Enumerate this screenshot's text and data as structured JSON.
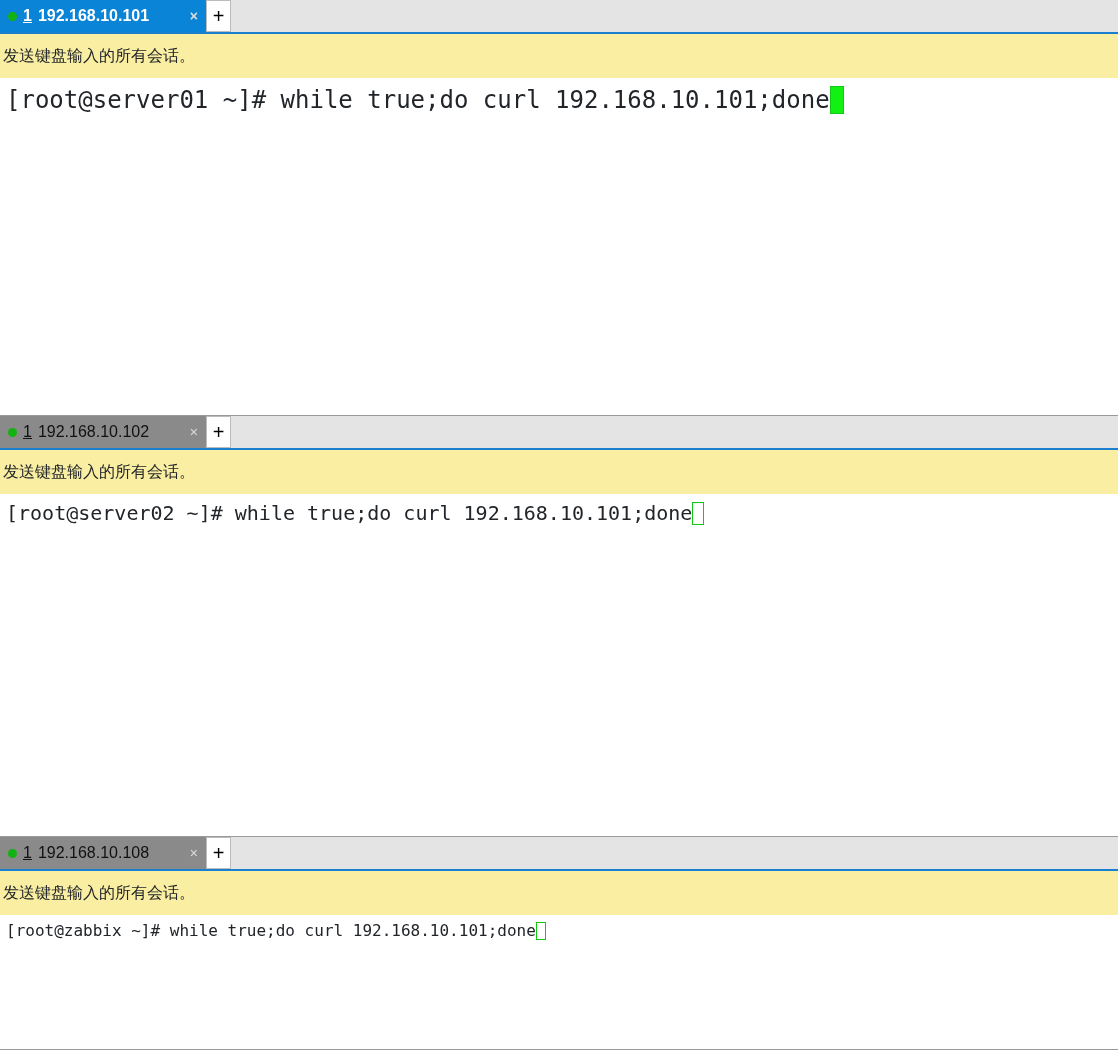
{
  "panes": [
    {
      "tab": {
        "index": "1",
        "host": "192.168.10.101",
        "selected": true,
        "close": "×"
      },
      "new_tab": "+",
      "banner": "发送键盘输入的所有会话。",
      "command_line": "[root@server01 ~]# while true;do curl 192.168.10.101;done",
      "focused": true
    },
    {
      "tab": {
        "index": "1",
        "host": "192.168.10.102",
        "selected": false,
        "close": "×"
      },
      "new_tab": "+",
      "banner": "发送键盘输入的所有会话。",
      "command_line": "[root@server02 ~]# while true;do curl 192.168.10.101;done",
      "focused": false
    },
    {
      "tab": {
        "index": "1",
        "host": "192.168.10.108",
        "selected": false,
        "close": "×"
      },
      "new_tab": "+",
      "banner": "发送键盘输入的所有会话。",
      "command_line": "[root@zabbix ~]# while true;do curl 192.168.10.101;done",
      "focused": false
    }
  ]
}
